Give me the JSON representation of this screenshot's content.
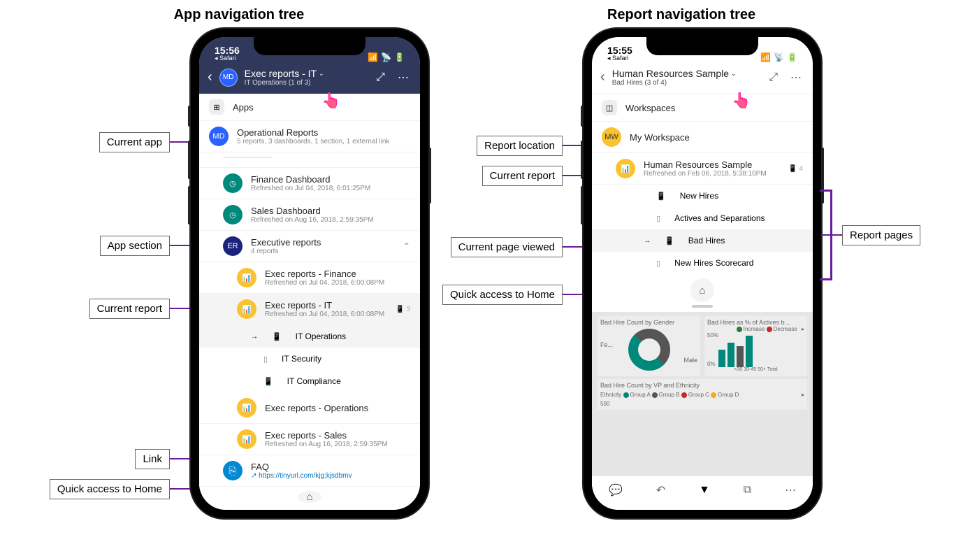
{
  "left": {
    "title": "App navigation tree",
    "labels": {
      "current_app": "Current app",
      "app_section": "App section",
      "current_report": "Current report",
      "link": "Link",
      "home": "Quick access to Home"
    },
    "status": {
      "time": "15:56",
      "sub": "◂ Safari"
    },
    "header": {
      "avatar": "MD",
      "title": "Exec reports - IT",
      "subtitle": "IT Operations (1 of 3)"
    },
    "rows": {
      "apps": "Apps",
      "op_reports": {
        "t": "Operational Reports",
        "s": "5 reports, 3 dashboards, 1 section, 1 external link"
      },
      "finance_dash": {
        "t": "Finance Dashboard",
        "s": "Refreshed on Jul 04, 2018, 6:01:25PM"
      },
      "sales_dash": {
        "t": "Sales Dashboard",
        "s": "Refreshed on Aug 16, 2018, 2:59:35PM"
      },
      "exec_section": {
        "t": "Executive reports",
        "s": "4 reports"
      },
      "exec_fin": {
        "t": "Exec reports - Finance",
        "s": "Refreshed on Jul 04, 2018, 6:00:08PM"
      },
      "exec_it": {
        "t": "Exec reports - IT",
        "s": "Refreshed on Jul 04, 2018, 6:00:08PM",
        "count": "3"
      },
      "p1": "IT Operations",
      "p2": "IT Security",
      "p3": "IT Compliance",
      "exec_ops": {
        "t": "Exec reports - Operations"
      },
      "exec_sales": {
        "t": "Exec reports - Sales",
        "s": "Refreshed on Aug 16, 2018, 2:59:35PM"
      },
      "faq": {
        "t": "FAQ",
        "url": "https://tinyurl.com/kjg;kjsdbmv"
      }
    }
  },
  "right": {
    "title": "Report navigation tree",
    "labels": {
      "report_location": "Report location",
      "current_report": "Current report",
      "current_page": "Current page viewed",
      "home": "Quick access to Home",
      "report_pages": "Report pages"
    },
    "status": {
      "time": "15:55",
      "sub": "◂ Safari"
    },
    "header": {
      "title": "Human Resources Sample",
      "subtitle": "Bad Hires (3 of 4)"
    },
    "rows": {
      "workspaces": "Workspaces",
      "my_ws": "My Workspace",
      "hr_sample": {
        "t": "Human Resources Sample",
        "s": "Refreshed on Feb 06, 2018, 5:38:10PM",
        "count": "4"
      },
      "p1": "New Hires",
      "p2": "Actives and Separations",
      "p3": "Bad Hires",
      "p4": "New Hires Scorecard"
    },
    "preview": {
      "c1_title": "Bad Hire Count by Gender",
      "c2_title": "Bad Hires as % of Actives b...",
      "legend_inc": "Increase",
      "legend_dec": "Decrease",
      "fe": "Fe...",
      "male": "Male",
      "y50": "50%",
      "y0": "0%",
      "x1": "<30",
      "x2": "30-49",
      "x3": "50+",
      "x4": "Total",
      "c3_title": "Bad Hire Count by VP and Ethnicity",
      "eth": "Ethnicity",
      "ga": "Group A",
      "gb": "Group B",
      "gc": "Group C",
      "gd": "Group D",
      "y500": "500"
    }
  }
}
